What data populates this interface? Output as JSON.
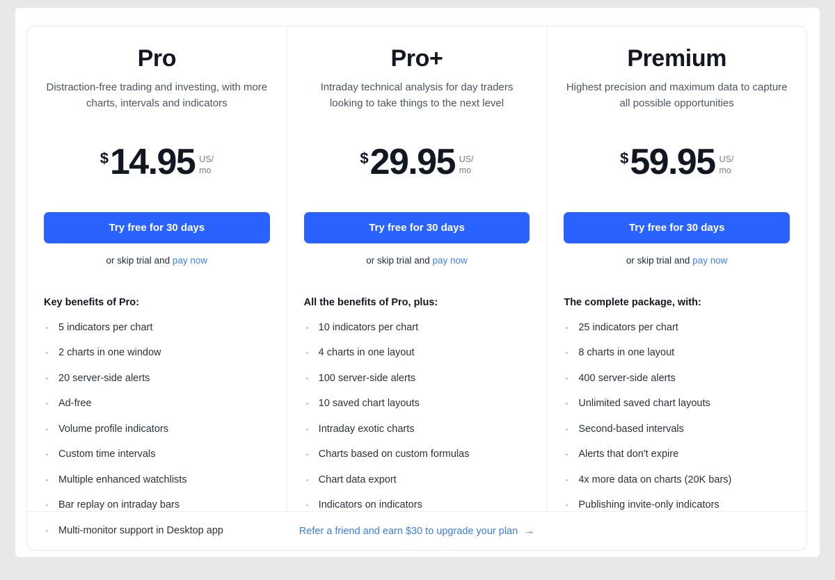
{
  "colors": {
    "accent_blue": "#2962ff",
    "link_blue": "#3b82f6",
    "referral_blue": "#3b7ddd",
    "text_dark": "#131722",
    "text_muted": "#787b86",
    "page_background": "#e8e8e8",
    "card_background": "#ffffff",
    "divider": "#eceef0"
  },
  "plans": [
    {
      "name": "Pro",
      "description": "Distraction-free trading and investing, with more charts, intervals and indicators",
      "currency_symbol": "$",
      "price": "14.95",
      "period": "US/\nmo",
      "cta_label": "Try free for 30 days",
      "skip_prefix": "or skip trial and ",
      "skip_link_label": "pay now",
      "benefits_heading": "Key benefits of Pro:",
      "benefits": [
        "5 indicators per chart",
        "2 charts in one window",
        "20 server-side alerts",
        "Ad-free",
        "Volume profile indicators",
        "Custom time intervals",
        "Multiple enhanced watchlists",
        "Bar replay on intraday bars",
        "Multi-monitor support in Desktop app"
      ]
    },
    {
      "name": "Pro+",
      "description": "Intraday technical analysis for day traders looking to take things to the next level",
      "currency_symbol": "$",
      "price": "29.95",
      "period": "US/\nmo",
      "cta_label": "Try free for 30 days",
      "skip_prefix": "or skip trial and ",
      "skip_link_label": "pay now",
      "benefits_heading": "All the benefits of Pro, plus:",
      "benefits": [
        "10 indicators per chart",
        "4 charts in one layout",
        "100 server-side alerts",
        "10 saved chart layouts",
        "Intraday exotic charts",
        "Charts based on custom formulas",
        "Chart data export",
        "Indicators on indicators"
      ]
    },
    {
      "name": "Premium",
      "description": "Highest precision and maximum data to capture all possible opportunities",
      "currency_symbol": "$",
      "price": "59.95",
      "period": "US/\nmo",
      "cta_label": "Try free for 30 days",
      "skip_prefix": "or skip trial and ",
      "skip_link_label": "pay now",
      "benefits_heading": "The complete package, with:",
      "benefits": [
        "25 indicators per chart",
        "8 charts in one layout",
        "400 server-side alerts",
        "Unlimited saved chart layouts",
        "Second-based intervals",
        "Alerts that don't expire",
        "4x more data on charts (20K bars)",
        "Publishing invite-only indicators"
      ]
    }
  ],
  "footer": {
    "referral_label": "Refer a friend and earn $30 to upgrade your plan",
    "arrow_icon": "→"
  }
}
